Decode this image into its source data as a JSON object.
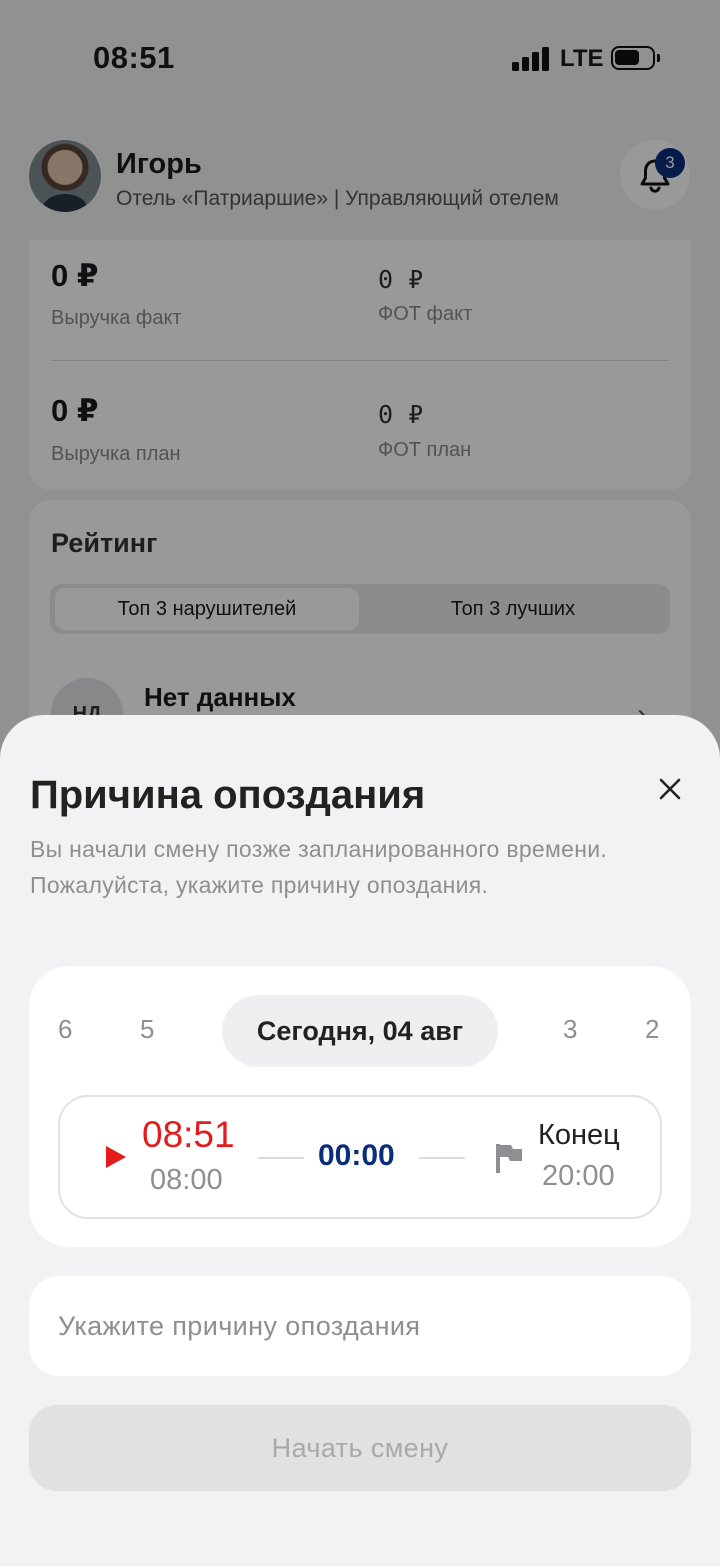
{
  "status_bar": {
    "time": "08:51",
    "network": "LTE",
    "icons": [
      "signal-icon",
      "battery-icon"
    ]
  },
  "profile": {
    "name": "Игорь",
    "subtitle": "Отель «Патриаршие» | Управляющий отелем",
    "notifications_count": "3",
    "icons": [
      "avatar",
      "bell-icon"
    ]
  },
  "finance": {
    "revenue_fact_value": "0 ₽",
    "revenue_fact_label": "Выручка факт",
    "payroll_fact_value": "0 ₽",
    "payroll_fact_label": "ФОТ факт",
    "revenue_plan_value": "0 ₽",
    "revenue_plan_label": "Выручка план",
    "payroll_plan_value": "0 ₽",
    "payroll_plan_label": "ФОТ план"
  },
  "rating": {
    "title": "Рейтинг",
    "tabs": [
      {
        "label": "Топ 3 нарушителей",
        "active": true
      },
      {
        "label": "Топ 3 лучших",
        "active": false
      }
    ],
    "empty_initials": "НД",
    "empty_text": "Нет данных"
  },
  "sheet": {
    "title": "Причина опоздания",
    "description_line1": "Вы начали смену позже запланированного времени.",
    "description_line2": "Пожалуйста, укажите причину опоздания.",
    "days": {
      "d6": "6",
      "d5": "5",
      "selected": "Сегодня, 04 авг",
      "d3": "3",
      "d2": "2"
    },
    "shift": {
      "start_actual": "08:51",
      "start_planned": "08:00",
      "duration": "00:00",
      "end_label": "Конец",
      "end_time": "20:00"
    },
    "reason_placeholder": "Укажите причину опоздания",
    "reason_value": "",
    "submit_label": "Начать смену",
    "colors": {
      "late": "#e31b1b",
      "accent": "#0b2e7a",
      "muted": "#8e8e93"
    },
    "icons": [
      "close-icon",
      "play-icon",
      "flag-icon"
    ]
  }
}
